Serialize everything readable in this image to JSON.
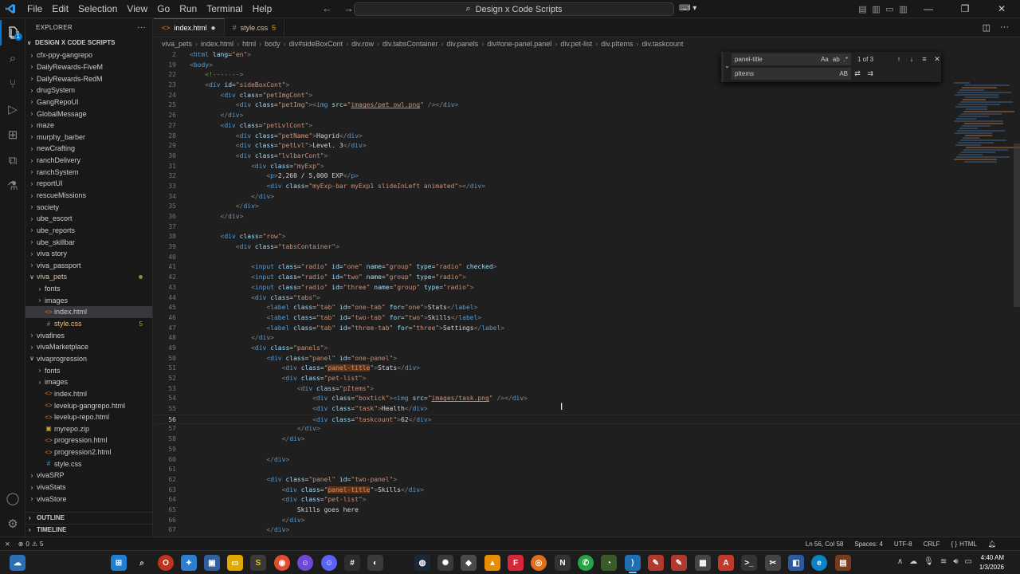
{
  "menu": [
    "File",
    "Edit",
    "Selection",
    "View",
    "Go",
    "Run",
    "Terminal",
    "Help"
  ],
  "command_center": "Design x Code Scripts",
  "sidebar": {
    "title": "EXPLORER",
    "root": "DESIGN X CODE SCRIPTS",
    "items": [
      {
        "label": "cfx-ppy-gangrepo",
        "depth": 1,
        "type": "folder",
        "open": false
      },
      {
        "label": "DailyRewards-FiveM",
        "depth": 1,
        "type": "folder",
        "open": false
      },
      {
        "label": "DailyRewards-RedM",
        "depth": 1,
        "type": "folder",
        "open": false
      },
      {
        "label": "drugSystem",
        "depth": 1,
        "type": "folder",
        "open": false
      },
      {
        "label": "GangRepoUI",
        "depth": 1,
        "type": "folder",
        "open": false
      },
      {
        "label": "GlobalMessage",
        "depth": 1,
        "type": "folder",
        "open": false
      },
      {
        "label": "maze",
        "depth": 1,
        "type": "folder",
        "open": false
      },
      {
        "label": "murphy_barber",
        "depth": 1,
        "type": "folder",
        "open": false
      },
      {
        "label": "newCrafting",
        "depth": 1,
        "type": "folder",
        "open": false
      },
      {
        "label": "ranchDelivery",
        "depth": 1,
        "type": "folder",
        "open": false
      },
      {
        "label": "ranchSystem",
        "depth": 1,
        "type": "folder",
        "open": false
      },
      {
        "label": "reportUI",
        "depth": 1,
        "type": "folder",
        "open": false
      },
      {
        "label": "rescueMissions",
        "depth": 1,
        "type": "folder",
        "open": false
      },
      {
        "label": "society",
        "depth": 1,
        "type": "folder",
        "open": false
      },
      {
        "label": "ube_escort",
        "depth": 1,
        "type": "folder",
        "open": false
      },
      {
        "label": "ube_reports",
        "depth": 1,
        "type": "folder",
        "open": false
      },
      {
        "label": "ube_skillbar",
        "depth": 1,
        "type": "folder",
        "open": false
      },
      {
        "label": "viva story",
        "depth": 1,
        "type": "folder",
        "open": false
      },
      {
        "label": "viva_passport",
        "depth": 1,
        "type": "folder",
        "open": false
      },
      {
        "label": "viva_pets",
        "depth": 1,
        "type": "folder",
        "open": true,
        "modified": true,
        "dot": true
      },
      {
        "label": "fonts",
        "depth": 2,
        "type": "folder",
        "open": false
      },
      {
        "label": "images",
        "depth": 2,
        "type": "folder",
        "open": false
      },
      {
        "label": "index.html",
        "depth": 2,
        "type": "html",
        "selected": true
      },
      {
        "label": "style.css",
        "depth": 2,
        "type": "css",
        "modified": true,
        "num": "5"
      },
      {
        "label": "vivafines",
        "depth": 1,
        "type": "folder",
        "open": false
      },
      {
        "label": "vivaMarketplace",
        "depth": 1,
        "type": "folder",
        "open": false
      },
      {
        "label": "vivaprogression",
        "depth": 1,
        "type": "folder",
        "open": true
      },
      {
        "label": "fonts",
        "depth": 2,
        "type": "folder",
        "open": false
      },
      {
        "label": "images",
        "depth": 2,
        "type": "folder",
        "open": false
      },
      {
        "label": "index.html",
        "depth": 2,
        "type": "html"
      },
      {
        "label": "levelup-gangrepo.html",
        "depth": 2,
        "type": "html"
      },
      {
        "label": "levelup-repo.html",
        "depth": 2,
        "type": "html"
      },
      {
        "label": "myrepo.zip",
        "depth": 2,
        "type": "zip"
      },
      {
        "label": "progression.html",
        "depth": 2,
        "type": "html"
      },
      {
        "label": "progression2.html",
        "depth": 2,
        "type": "html"
      },
      {
        "label": "style.css",
        "depth": 2,
        "type": "css"
      },
      {
        "label": "vivaSRP",
        "depth": 1,
        "type": "folder",
        "open": false
      },
      {
        "label": "vivaStats",
        "depth": 1,
        "type": "folder",
        "open": false
      },
      {
        "label": "vivaStore",
        "depth": 1,
        "type": "folder",
        "open": false
      }
    ],
    "outline": "OUTLINE",
    "timeline": "TIMELINE"
  },
  "tabs": [
    {
      "label": "index.html",
      "active": true,
      "dirty": true,
      "icon": "html-icon"
    },
    {
      "label": "style.css",
      "active": false,
      "num": "5",
      "icon": "css-icon"
    }
  ],
  "breadcrumb": [
    "viva_pets",
    "index.html",
    "html",
    "body",
    "div#sideBoxCont",
    "div.row",
    "div.tabsContainer",
    "div.panels",
    "div#one-panel.panel",
    "div.pet-list",
    "div.pItems",
    "div.taskcount"
  ],
  "find_widget": {
    "find_value": "panel-title",
    "match_count": "1 of 3",
    "replace_value": "pItems",
    "find_opts": [
      "Aa",
      "ab",
      ".*"
    ],
    "replace_opts": [
      "AB"
    ]
  },
  "code": {
    "current_line": 56,
    "lines": [
      {
        "n": 2,
        "sticky": true,
        "html": "<span class='p'>&lt;</span><span class='t'>html</span> <span class='a'>lang</span>=<span class='s'>\"en\"</span><span class='p'>&gt;</span>"
      },
      {
        "n": 19,
        "sticky": true,
        "html": "<span class='p'>&lt;</span><span class='t'>body</span><span class='p'>&gt;</span>"
      },
      {
        "n": 22,
        "html": "    <span class='c'>&lt;!-------&gt;</span>"
      },
      {
        "n": 23,
        "html": "    <span class='p'>&lt;</span><span class='t'>div</span> <span class='a'>id</span>=<span class='s'>\"sideBoxCont\"</span><span class='p'>&gt;</span>"
      },
      {
        "n": 24,
        "html": "        <span class='p'>&lt;</span><span class='t'>div</span> <span class='a'>class</span>=<span class='s'>\"petImgCont\"</span><span class='p'>&gt;</span>"
      },
      {
        "n": 25,
        "html": "            <span class='p'>&lt;</span><span class='t'>div</span> <span class='a'>class</span>=<span class='s'>\"petImg\"</span><span class='p'>&gt;&lt;</span><span class='t'>img</span> <span class='a'>src</span>=<span class='s'>\"<u>images/pet_owl.png</u>\"</span> <span class='p'>/&gt;&lt;/</span><span class='t'>div</span><span class='p'>&gt;</span>"
      },
      {
        "n": 26,
        "html": "        <span class='p'>&lt;/</span><span class='t'>div</span><span class='p'>&gt;</span>"
      },
      {
        "n": 27,
        "html": "        <span class='p'>&lt;</span><span class='t'>div</span> <span class='a'>class</span>=<span class='s'>\"petLvlCont\"</span><span class='p'>&gt;</span>"
      },
      {
        "n": 28,
        "html": "            <span class='p'>&lt;</span><span class='t'>div</span> <span class='a'>class</span>=<span class='s'>\"petName\"</span><span class='p'>&gt;</span><span class='x'>Hagrid</span><span class='p'>&lt;/</span><span class='t'>div</span><span class='p'>&gt;</span>"
      },
      {
        "n": 29,
        "html": "            <span class='p'>&lt;</span><span class='t'>div</span> <span class='a'>class</span>=<span class='s'>\"petLvl\"</span><span class='p'>&gt;</span><span class='x'>Level. 3</span><span class='p'>&lt;/</span><span class='t'>div</span><span class='p'>&gt;</span>"
      },
      {
        "n": 30,
        "html": "            <span class='p'>&lt;</span><span class='t'>div</span> <span class='a'>class</span>=<span class='s'>\"lvlbarCont\"</span><span class='p'>&gt;</span>"
      },
      {
        "n": 31,
        "html": "                <span class='p'>&lt;</span><span class='t'>div</span> <span class='a'>class</span>=<span class='s'>\"myExp\"</span><span class='p'>&gt;</span>"
      },
      {
        "n": 32,
        "html": "                    <span class='p'>&lt;</span><span class='t'>p</span><span class='p'>&gt;</span><span class='x'>2,260 / 5,000 EXP</span><span class='p'>&lt;/</span><span class='t'>p</span><span class='p'>&gt;</span>"
      },
      {
        "n": 33,
        "html": "                    <span class='p'>&lt;</span><span class='t'>div</span> <span class='a'>class</span>=<span class='s'>\"myExp-bar myExp1 slideInLeft animated\"</span><span class='p'>&gt;&lt;/</span><span class='t'>div</span><span class='p'>&gt;</span>"
      },
      {
        "n": 34,
        "html": "                <span class='p'>&lt;/</span><span class='t'>div</span><span class='p'>&gt;</span>"
      },
      {
        "n": 35,
        "html": "            <span class='p'>&lt;/</span><span class='t'>div</span><span class='p'>&gt;</span>"
      },
      {
        "n": 36,
        "html": "        <span class='p'>&lt;/</span><span class='t'>div</span><span class='p'>&gt;</span>"
      },
      {
        "n": 37,
        "html": ""
      },
      {
        "n": 38,
        "html": "        <span class='p'>&lt;</span><span class='t'>div</span> <span class='a'>class</span>=<span class='s'>\"row\"</span><span class='p'>&gt;</span>"
      },
      {
        "n": 39,
        "html": "            <span class='p'>&lt;</span><span class='t'>div</span> <span class='a'>class</span>=<span class='s'>\"tabsContainer\"</span><span class='p'>&gt;</span>"
      },
      {
        "n": 40,
        "html": ""
      },
      {
        "n": 41,
        "html": "                <span class='p'>&lt;</span><span class='t'>input</span> <span class='a'>class</span>=<span class='s'>\"radio\"</span> <span class='a'>id</span>=<span class='s'>\"one\"</span> <span class='a'>name</span>=<span class='s'>\"group\"</span> <span class='a'>type</span>=<span class='s'>\"radio\"</span> <span class='a'>checked</span><span class='p'>&gt;</span>"
      },
      {
        "n": 42,
        "html": "                <span class='p'>&lt;</span><span class='t'>input</span> <span class='a'>class</span>=<span class='s'>\"radio\"</span> <span class='a'>id</span>=<span class='s'>\"two\"</span> <span class='a'>name</span>=<span class='s'>\"group\"</span> <span class='a'>type</span>=<span class='s'>\"radio\"</span><span class='p'>&gt;</span>"
      },
      {
        "n": 43,
        "html": "                <span class='p'>&lt;</span><span class='t'>input</span> <span class='a'>class</span>=<span class='s'>\"radio\"</span> <span class='a'>id</span>=<span class='s'>\"three\"</span> <span class='a'>name</span>=<span class='s'>\"group\"</span> <span class='a'>type</span>=<span class='s'>\"radio\"</span><span class='p'>&gt;</span>"
      },
      {
        "n": 44,
        "html": "                <span class='p'>&lt;</span><span class='t'>div</span> <span class='a'>class</span>=<span class='s'>\"tabs\"</span><span class='p'>&gt;</span>"
      },
      {
        "n": 45,
        "html": "                    <span class='p'>&lt;</span><span class='t'>label</span> <span class='a'>class</span>=<span class='s'>\"tab\"</span> <span class='a'>id</span>=<span class='s'>\"one-tab\"</span> <span class='a'>for</span>=<span class='s'>\"one\"</span><span class='p'>&gt;</span><span class='x'>Stats</span><span class='p'>&lt;/</span><span class='t'>label</span><span class='p'>&gt;</span>"
      },
      {
        "n": 46,
        "html": "                    <span class='p'>&lt;</span><span class='t'>label</span> <span class='a'>class</span>=<span class='s'>\"tab\"</span> <span class='a'>id</span>=<span class='s'>\"two-tab\"</span> <span class='a'>for</span>=<span class='s'>\"two\"</span><span class='p'>&gt;</span><span class='x'>Skills</span><span class='p'>&lt;/</span><span class='t'>label</span><span class='p'>&gt;</span>"
      },
      {
        "n": 47,
        "html": "                    <span class='p'>&lt;</span><span class='t'>label</span> <span class='a'>class</span>=<span class='s'>\"tab\"</span> <span class='a'>id</span>=<span class='s'>\"three-tab\"</span> <span class='a'>for</span>=<span class='s'>\"three\"</span><span class='p'>&gt;</span><span class='x'>Settings</span><span class='p'>&lt;/</span><span class='t'>label</span><span class='p'>&gt;</span>"
      },
      {
        "n": 48,
        "html": "                <span class='p'>&lt;/</span><span class='t'>div</span><span class='p'>&gt;</span>"
      },
      {
        "n": 49,
        "html": "                <span class='p'>&lt;</span><span class='t'>div</span> <span class='a'>class</span>=<span class='s'>\"panels\"</span><span class='p'>&gt;</span>"
      },
      {
        "n": 50,
        "html": "                    <span class='p'>&lt;</span><span class='t'>div</span> <span class='a'>class</span>=<span class='s'>\"panel\"</span> <span class='a'>id</span>=<span class='s'>\"one-panel\"</span><span class='p'>&gt;</span>"
      },
      {
        "n": 51,
        "html": "                        <span class='p'>&lt;</span><span class='t'>div</span> <span class='a'>class</span>=<span class='s'>\"<span class='hl'>panel-title</span>\"</span><span class='p'>&gt;</span><span class='x'>Stats</span><span class='p'>&lt;/</span><span class='t'>div</span><span class='p'>&gt;</span>"
      },
      {
        "n": 52,
        "html": "                        <span class='p'>&lt;</span><span class='t'>div</span> <span class='a'>class</span>=<span class='s'>\"pet-list\"</span><span class='p'>&gt;</span>"
      },
      {
        "n": 53,
        "html": "                            <span class='p'>&lt;</span><span class='t'>div</span> <span class='a'>class</span>=<span class='s'>\"pItems\"</span><span class='p'>&gt;</span>"
      },
      {
        "n": 54,
        "html": "                                <span class='p'>&lt;</span><span class='t'>div</span> <span class='a'>class</span>=<span class='s'>\"boxtick\"</span><span class='p'>&gt;&lt;</span><span class='t'>img</span> <span class='a'>src</span>=<span class='s'>\"<u>images/task.png</u>\"</span> <span class='p'>/&gt;&lt;/</span><span class='t'>div</span><span class='p'>&gt;</span>"
      },
      {
        "n": 55,
        "html": "                                <span class='p'>&lt;</span><span class='t'>div</span> <span class='a'>class</span>=<span class='s'>\"task\"</span><span class='p'>&gt;</span><span class='x'>Health</span><span class='p'>&lt;/</span><span class='t'>div</span><span class='p'>&gt;</span>"
      },
      {
        "n": 56,
        "html": "                                <span class='p'>&lt;</span><span class='t'>div</span> <span class='a'>class</span>=<span class='s'>\"taskcount\"</span><span class='p'>&gt;</span><span class='x'>62</span><span class='p'>&lt;/</span><span class='t'>div</span><span class='p'>&gt;</span>"
      },
      {
        "n": 57,
        "html": "                            <span class='p'>&lt;/</span><span class='t'>div</span><span class='p'>&gt;</span>"
      },
      {
        "n": 58,
        "html": "                        <span class='p'>&lt;/</span><span class='t'>div</span><span class='p'>&gt;</span>"
      },
      {
        "n": 59,
        "html": ""
      },
      {
        "n": 60,
        "html": "                    <span class='p'>&lt;/</span><span class='t'>div</span><span class='p'>&gt;</span>"
      },
      {
        "n": 61,
        "html": ""
      },
      {
        "n": 62,
        "html": "                    <span class='p'>&lt;</span><span class='t'>div</span> <span class='a'>class</span>=<span class='s'>\"panel\"</span> <span class='a'>id</span>=<span class='s'>\"two-panel\"</span><span class='p'>&gt;</span>"
      },
      {
        "n": 63,
        "html": "                        <span class='p'>&lt;</span><span class='t'>div</span> <span class='a'>class</span>=<span class='s'>\"<span class='hl'>panel-title</span>\"</span><span class='p'>&gt;</span><span class='x'>Skills</span><span class='p'>&lt;/</span><span class='t'>div</span><span class='p'>&gt;</span>"
      },
      {
        "n": 64,
        "html": "                        <span class='p'>&lt;</span><span class='t'>div</span> <span class='a'>class</span>=<span class='s'>\"pet-list\"</span><span class='p'>&gt;</span>"
      },
      {
        "n": 65,
        "html": "                            <span class='x'>Skills goes here</span>"
      },
      {
        "n": 66,
        "html": "                        <span class='p'>&lt;/</span><span class='t'>div</span><span class='p'>&gt;</span>"
      },
      {
        "n": 67,
        "html": "                    <span class='p'>&lt;/</span><span class='t'>div</span><span class='p'>&gt;</span>"
      }
    ]
  },
  "status": {
    "remote": "⨯",
    "errors": "0",
    "warnings": "5",
    "cursor": "Ln 56, Col 58",
    "spaces": "Spaces: 4",
    "encoding": "UTF-8",
    "eol": "CRLF",
    "language": "HTML"
  },
  "taskbar": {
    "time": "4:40 AM",
    "date": "1/3/2026"
  },
  "colors": {
    "accent": "#0078d4",
    "editor_bg": "#1f1f1f",
    "chrome_bg": "#181818",
    "find_highlight": "#613214"
  }
}
